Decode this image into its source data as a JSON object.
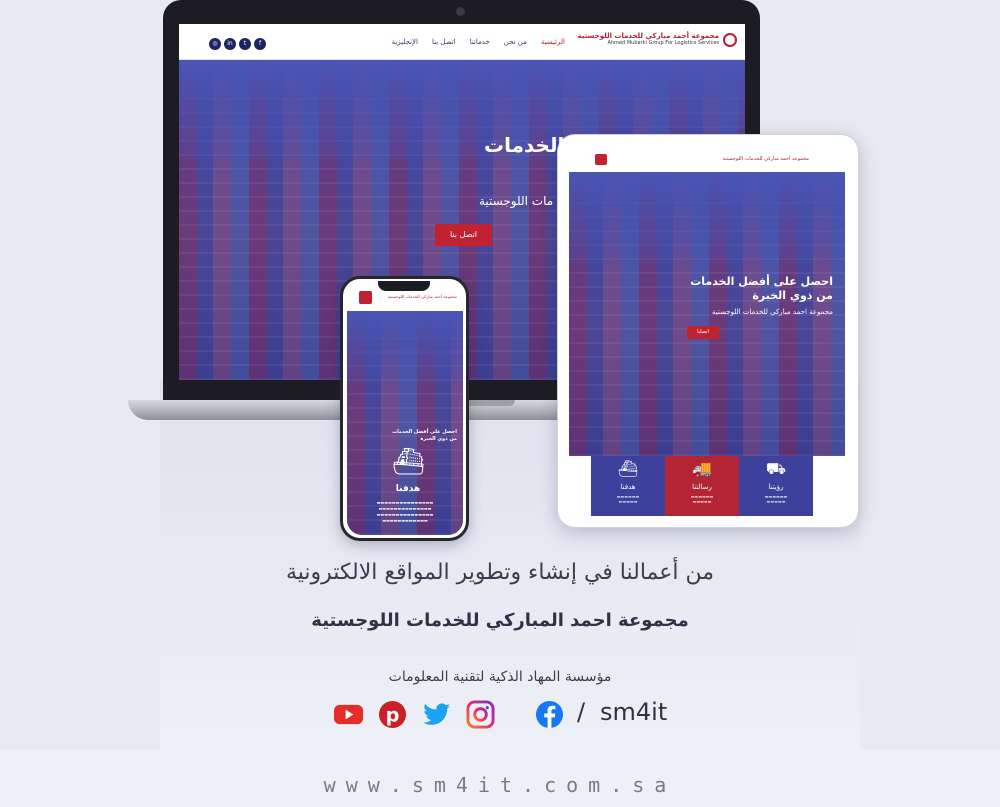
{
  "laptop": {
    "logo_line1": "مجموعة أحمد مباركي للخدمات اللوجستية",
    "logo_line2": "Ahmed Mubarki Group For Logistics Services",
    "nav": [
      "الرئيسية",
      "من نحن",
      "خدماتنا",
      "اتصل بنا",
      "الإنجليزية"
    ],
    "hero_title": "الخدمات",
    "hero_subtitle": "مات اللوجستية",
    "cta": "اتصل بنا"
  },
  "tablet": {
    "hero_title_line1": "احصل على أفضل الخدمات",
    "hero_title_line2": "من ذوي الخبرة",
    "hero_subtitle": "مجموعة احمد مباركي للخدمات اللوجستية",
    "cta": "اتصلنا",
    "cards": [
      {
        "label": "هدفنا",
        "icon": "ship-icon"
      },
      {
        "label": "رسالتنا",
        "icon": "truck-icon"
      },
      {
        "label": "رؤيتنا",
        "icon": "forklift-icon"
      }
    ]
  },
  "phone": {
    "hero_title_line1": "احصل على أفضل الخدمات",
    "hero_title_line2": "من ذوي الخبرة",
    "goal_label": "هدفنا"
  },
  "headline": "من أعمالنا في إنشاء وتطوير المواقع الالكترونية",
  "subheadline": "مجموعة احمد المباركي للخدمات اللوجستية",
  "company": "مؤسسة المهاد الذكية لتقنية المعلومات",
  "handle": "sm4it",
  "slash": "/",
  "social_icons": [
    "youtube-icon",
    "pinterest-icon",
    "twitter-icon",
    "instagram-icon",
    "facebook-icon"
  ],
  "url": "www.sm4it.com.sa",
  "colors": {
    "brand_red": "#c0232f",
    "brand_blue": "#3d419c",
    "youtube": "#e52d27",
    "pinterest": "#cb2027",
    "twitter": "#1da1f2",
    "instagram": "#c13584",
    "facebook": "#1877f2"
  }
}
